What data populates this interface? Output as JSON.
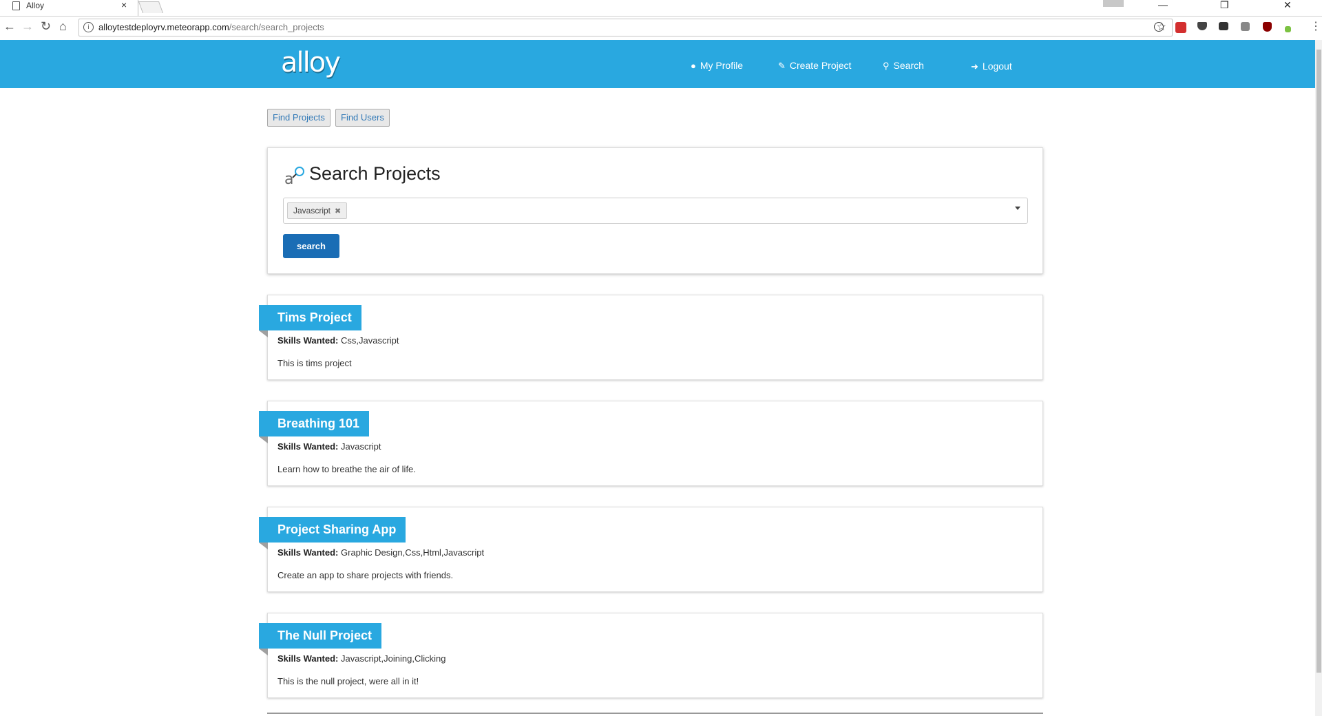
{
  "browser": {
    "tab_title": "Alloy",
    "tab_close": "×",
    "url_host": "alloytestdeployrv.meteorapp.com",
    "url_path": "/search/search_projects",
    "window_buttons": {
      "minimize": "—",
      "restore": "❐",
      "close": "✕"
    }
  },
  "header": {
    "logo": "alloy",
    "nav": [
      {
        "label": "My Profile",
        "icon": "user-icon"
      },
      {
        "label": "Create Project",
        "icon": "edit-icon"
      },
      {
        "label": "Search",
        "icon": "search-icon"
      },
      {
        "label": "Logout",
        "icon": "logout-icon"
      }
    ],
    "colors": {
      "brand": "#29a8e0"
    }
  },
  "subnav": {
    "find_projects": "Find Projects",
    "find_users": "Find Users"
  },
  "search": {
    "title": "Search Projects",
    "selected_tags": [
      "Javascript"
    ],
    "button": "search"
  },
  "projects": [
    {
      "title": "Tims Project",
      "skills_label": "Skills Wanted:",
      "skills": "Css,Javascript",
      "description": "This is tims project"
    },
    {
      "title": "Breathing 101",
      "skills_label": "Skills Wanted:",
      "skills": "Javascript",
      "description": "Learn how to breathe the air of life."
    },
    {
      "title": "Project Sharing App",
      "skills_label": "Skills Wanted:",
      "skills": "Graphic Design,Css,Html,Javascript",
      "description": "Create an app to share projects with friends."
    },
    {
      "title": "The Null Project",
      "skills_label": "Skills Wanted:",
      "skills": "Javascript,Joining,Clicking",
      "description": "This is the null project, were all in it!"
    }
  ]
}
